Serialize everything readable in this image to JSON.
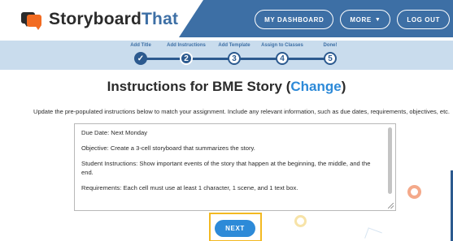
{
  "header": {
    "logo_part1": "Storyboard",
    "logo_part2": "That",
    "nav": {
      "dashboard": "MY DASHBOARD",
      "more": "MORE",
      "logout": "LOG OUT"
    }
  },
  "stepper": {
    "steps": [
      {
        "label": "Add Title",
        "number": "✓",
        "state": "done"
      },
      {
        "label": "Add Instructions",
        "number": "2",
        "state": "active"
      },
      {
        "label": "Add Template",
        "number": "3",
        "state": "todo"
      },
      {
        "label": "Assign to Classes",
        "number": "4",
        "state": "todo"
      },
      {
        "label": "Done!",
        "number": "5",
        "state": "todo"
      }
    ]
  },
  "main": {
    "title_prefix": "Instructions for BME Story (",
    "title_link": "Change",
    "title_suffix": ")",
    "subtitle": "Update the pre-populated instructions below to match your assignment. Include any relevant information, such as due dates, requirements, objectives, etc.",
    "instructions": [
      "Due Date: Next Monday",
      "Objective: Create a 3-cell storyboard that summarizes the story.",
      "Student Instructions: Show important events of the story that happen at the beginning, the middle, and the end.",
      "Requirements: Each cell must use at least 1 character, 1 scene, and 1 text box."
    ],
    "next_label": "NEXT"
  },
  "colors": {
    "header_blue": "#3d6fa5",
    "stepper_bg": "#c9dced",
    "accent_blue": "#2d8ad8",
    "logo_orange": "#f26b21",
    "highlight_yellow": "#f3b921"
  }
}
